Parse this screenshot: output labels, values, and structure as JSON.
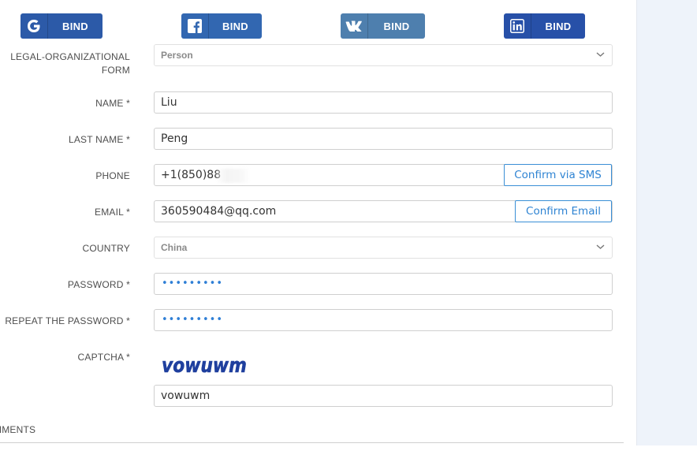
{
  "social": {
    "google": {
      "label": "BIND",
      "icon": "google-icon",
      "color": "#2c5aa8"
    },
    "facebook": {
      "label": "BIND",
      "icon": "facebook-icon",
      "color": "#3267b1"
    },
    "vk": {
      "label": "BIND",
      "icon": "vk-icon",
      "color": "#4e7fae"
    },
    "linkedin": {
      "label": "BIND",
      "icon": "linkedin-icon",
      "color": "#2750a8"
    }
  },
  "form": {
    "legal_form": {
      "label_line1": "LEGAL-ORGANIZATIONAL",
      "label_line2": "FORM",
      "value": "Person"
    },
    "name": {
      "label": "NAME *",
      "value": "Liu"
    },
    "last_name": {
      "label": "LAST NAME *",
      "value": "Peng"
    },
    "phone": {
      "label": "PHONE",
      "value": "+1(850)88",
      "confirm_label": "Confirm via SMS"
    },
    "email": {
      "label": "EMAIL *",
      "value": "360590484@qq.com",
      "confirm_label": "Confirm Email"
    },
    "country": {
      "label": "COUNTRY",
      "value": "China"
    },
    "password": {
      "label": "PASSWORD *",
      "dots": "•••••••••"
    },
    "repeat_password": {
      "label": "REPEAT THE PASSWORD *",
      "dots": "•••••••••"
    },
    "captcha": {
      "label": "CAPTCHA *",
      "image_text": "vowuwm",
      "value": "vowuwm"
    },
    "comments": {
      "label": "MMENTS"
    }
  },
  "colors": {
    "accent": "#2f84d3",
    "captcha": "#1f3f9e"
  }
}
